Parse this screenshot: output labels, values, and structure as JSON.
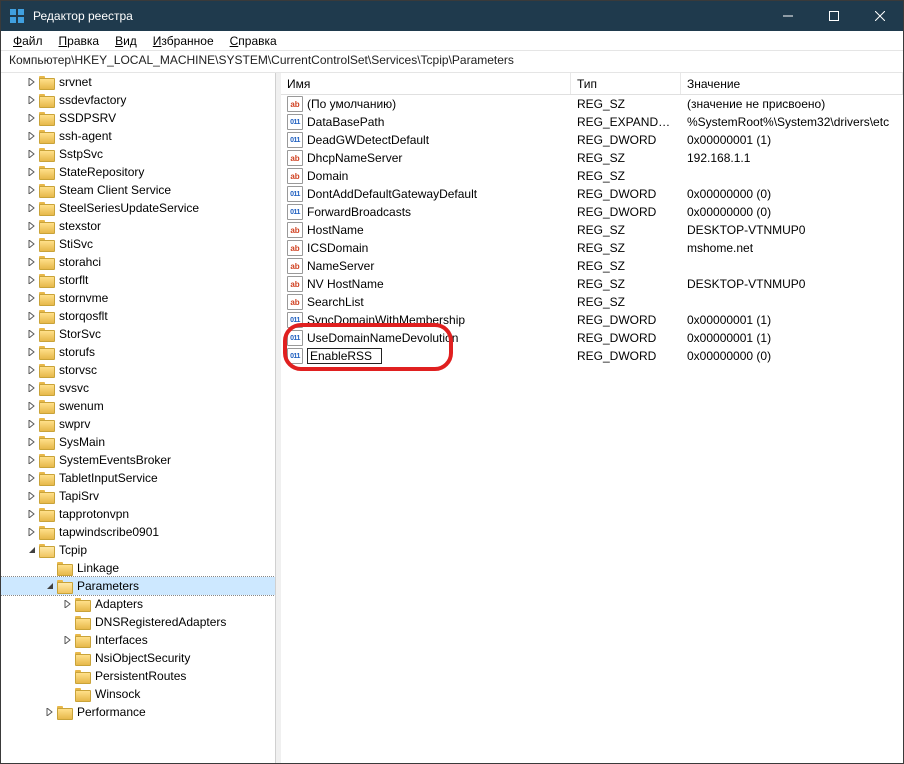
{
  "title": "Редактор реестра",
  "menu": {
    "file": "Файл",
    "edit": "Правка",
    "view": "Вид",
    "favorites": "Избранное",
    "help": "Справка"
  },
  "address": "Компьютер\\HKEY_LOCAL_MACHINE\\SYSTEM\\CurrentControlSet\\Services\\Tcpip\\Parameters",
  "headers": {
    "name": "Имя",
    "type": "Тип",
    "value": "Значение"
  },
  "tree": [
    {
      "label": "srvnet",
      "level": 1,
      "expander": ">"
    },
    {
      "label": "ssdevfactory",
      "level": 1,
      "expander": ">"
    },
    {
      "label": "SSDPSRV",
      "level": 1,
      "expander": ">"
    },
    {
      "label": "ssh-agent",
      "level": 1,
      "expander": ">"
    },
    {
      "label": "SstpSvc",
      "level": 1,
      "expander": ">"
    },
    {
      "label": "StateRepository",
      "level": 1,
      "expander": ">"
    },
    {
      "label": "Steam Client Service",
      "level": 1,
      "expander": ">"
    },
    {
      "label": "SteelSeriesUpdateService",
      "level": 1,
      "expander": ">"
    },
    {
      "label": "stexstor",
      "level": 1,
      "expander": ">"
    },
    {
      "label": "StiSvc",
      "level": 1,
      "expander": ">"
    },
    {
      "label": "storahci",
      "level": 1,
      "expander": ">"
    },
    {
      "label": "storflt",
      "level": 1,
      "expander": ">"
    },
    {
      "label": "stornvme",
      "level": 1,
      "expander": ">"
    },
    {
      "label": "storqosflt",
      "level": 1,
      "expander": ">"
    },
    {
      "label": "StorSvc",
      "level": 1,
      "expander": ">"
    },
    {
      "label": "storufs",
      "level": 1,
      "expander": ">"
    },
    {
      "label": "storvsc",
      "level": 1,
      "expander": ">"
    },
    {
      "label": "svsvc",
      "level": 1,
      "expander": ">"
    },
    {
      "label": "swenum",
      "level": 1,
      "expander": ">"
    },
    {
      "label": "swprv",
      "level": 1,
      "expander": ">"
    },
    {
      "label": "SysMain",
      "level": 1,
      "expander": ">"
    },
    {
      "label": "SystemEventsBroker",
      "level": 1,
      "expander": ">"
    },
    {
      "label": "TabletInputService",
      "level": 1,
      "expander": ">"
    },
    {
      "label": "TapiSrv",
      "level": 1,
      "expander": ">"
    },
    {
      "label": "tapprotonvpn",
      "level": 1,
      "expander": ">"
    },
    {
      "label": "tapwindscribe0901",
      "level": 1,
      "expander": ">"
    },
    {
      "label": "Tcpip",
      "level": 1,
      "expander": "v",
      "open": true
    },
    {
      "label": "Linkage",
      "level": 2,
      "expander": ""
    },
    {
      "label": "Parameters",
      "level": 2,
      "expander": "v",
      "open": true,
      "selected": true
    },
    {
      "label": "Adapters",
      "level": 3,
      "expander": ">"
    },
    {
      "label": "DNSRegisteredAdapters",
      "level": 3,
      "expander": ""
    },
    {
      "label": "Interfaces",
      "level": 3,
      "expander": ">"
    },
    {
      "label": "NsiObjectSecurity",
      "level": 3,
      "expander": ""
    },
    {
      "label": "PersistentRoutes",
      "level": 3,
      "expander": ""
    },
    {
      "label": "Winsock",
      "level": 3,
      "expander": ""
    },
    {
      "label": "Performance",
      "level": 2,
      "expander": ">"
    }
  ],
  "rows": [
    {
      "icon": "str",
      "name": "(По умолчанию)",
      "type": "REG_SZ",
      "value": "(значение не присвоено)"
    },
    {
      "icon": "bin",
      "name": "DataBasePath",
      "type": "REG_EXPAND_SZ",
      "value": "%SystemRoot%\\System32\\drivers\\etc"
    },
    {
      "icon": "bin",
      "name": "DeadGWDetectDefault",
      "type": "REG_DWORD",
      "value": "0x00000001 (1)"
    },
    {
      "icon": "str",
      "name": "DhcpNameServer",
      "type": "REG_SZ",
      "value": "192.168.1.1"
    },
    {
      "icon": "str",
      "name": "Domain",
      "type": "REG_SZ",
      "value": ""
    },
    {
      "icon": "bin",
      "name": "DontAddDefaultGatewayDefault",
      "type": "REG_DWORD",
      "value": "0x00000000 (0)"
    },
    {
      "icon": "bin",
      "name": "ForwardBroadcasts",
      "type": "REG_DWORD",
      "value": "0x00000000 (0)"
    },
    {
      "icon": "str",
      "name": "HostName",
      "type": "REG_SZ",
      "value": "DESKTOP-VTNMUP0"
    },
    {
      "icon": "str",
      "name": "ICSDomain",
      "type": "REG_SZ",
      "value": "mshome.net"
    },
    {
      "icon": "str",
      "name": "NameServer",
      "type": "REG_SZ",
      "value": ""
    },
    {
      "icon": "str",
      "name": "NV HostName",
      "type": "REG_SZ",
      "value": "DESKTOP-VTNMUP0"
    },
    {
      "icon": "str",
      "name": "SearchList",
      "type": "REG_SZ",
      "value": ""
    },
    {
      "icon": "bin",
      "name": "SyncDomainWithMembership",
      "type": "REG_DWORD",
      "value": "0x00000001 (1)"
    },
    {
      "icon": "bin",
      "name": "UseDomainNameDevolution",
      "type": "REG_DWORD",
      "value": "0x00000001 (1)"
    },
    {
      "icon": "bin",
      "name": "EnableRSS",
      "type": "REG_DWORD",
      "value": "0x00000000 (0)",
      "editing": true
    }
  ],
  "editing_value": "EnableRSS"
}
